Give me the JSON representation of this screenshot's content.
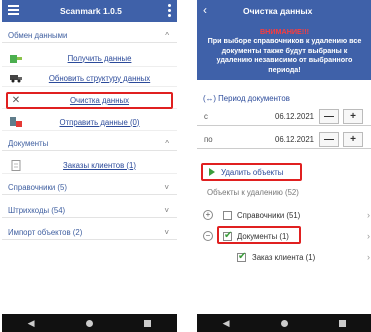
{
  "left": {
    "title": "Scanmark 1.0.5",
    "sections": {
      "exchange": "Обмен данными",
      "documents": "Документы",
      "references": "Справочники (5)",
      "barcodes": "Штрихкоды (54)",
      "import": "Импорт объектов (2)"
    },
    "items": {
      "receive": "Получить данные",
      "update_structure": "Обновить структуру данных",
      "clear": "Очистка данных",
      "send": "Отправить данные (0)",
      "orders": "Заказы клиентов (1)"
    }
  },
  "right": {
    "title": "Очистка данных",
    "warning_title": "ВНИМАНИЕ!!!",
    "warning_text": "При выборе справочников к удалению все документы также будут выбраны к удалению независимо от выбранного периода!",
    "period_label": "Период документов",
    "from_label": "с",
    "to_label": "по",
    "from_value": "06.12.2021",
    "to_value": "06.12.2021",
    "minus": "—",
    "plus": "+",
    "delete_label": "Удалить объекты",
    "objects_label": "Объекты к удалению (52)",
    "tree": {
      "references": "Справочники (51)",
      "documents": "Документы (1)",
      "order": "Заказ клиента (1)"
    }
  },
  "colors": {
    "header": "#3f61a9",
    "highlight": "#e02020",
    "check": "#3b9d3b"
  }
}
